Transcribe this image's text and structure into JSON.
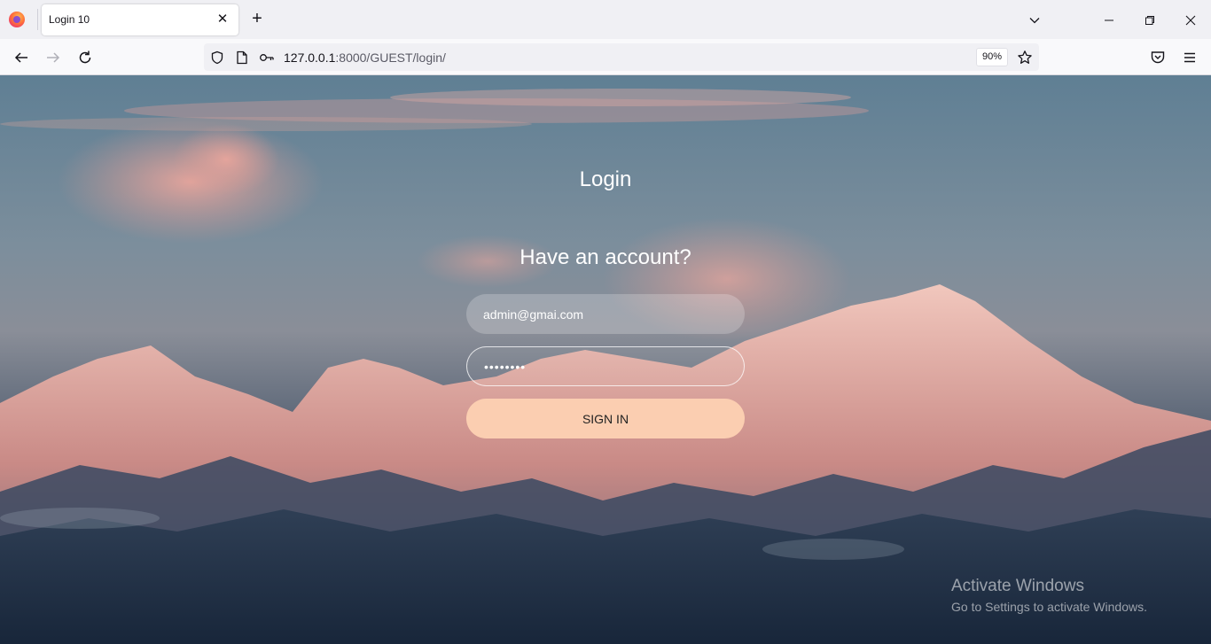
{
  "browser": {
    "tab_title": "Login 10",
    "tab_close": "✕",
    "new_tab": "+",
    "url_host": "127.0.0.1",
    "url_path": ":8000/GUEST/login/",
    "zoom": "90%",
    "icons": [
      "firefox-logo",
      "back-arrow",
      "forward-arrow",
      "reload",
      "shield",
      "page",
      "key",
      "star",
      "pocket",
      "menu",
      "tab-list-chevron",
      "minimize",
      "restore",
      "close"
    ]
  },
  "page": {
    "title": "Login",
    "subtitle": "Have an account?",
    "email_value": "admin@gmai.com",
    "password_value": "••••••••",
    "signin_label": "SIGN IN",
    "accent_color": "#fbceb1"
  },
  "watermark": {
    "title": "Activate Windows",
    "subtitle": "Go to Settings to activate Windows."
  }
}
